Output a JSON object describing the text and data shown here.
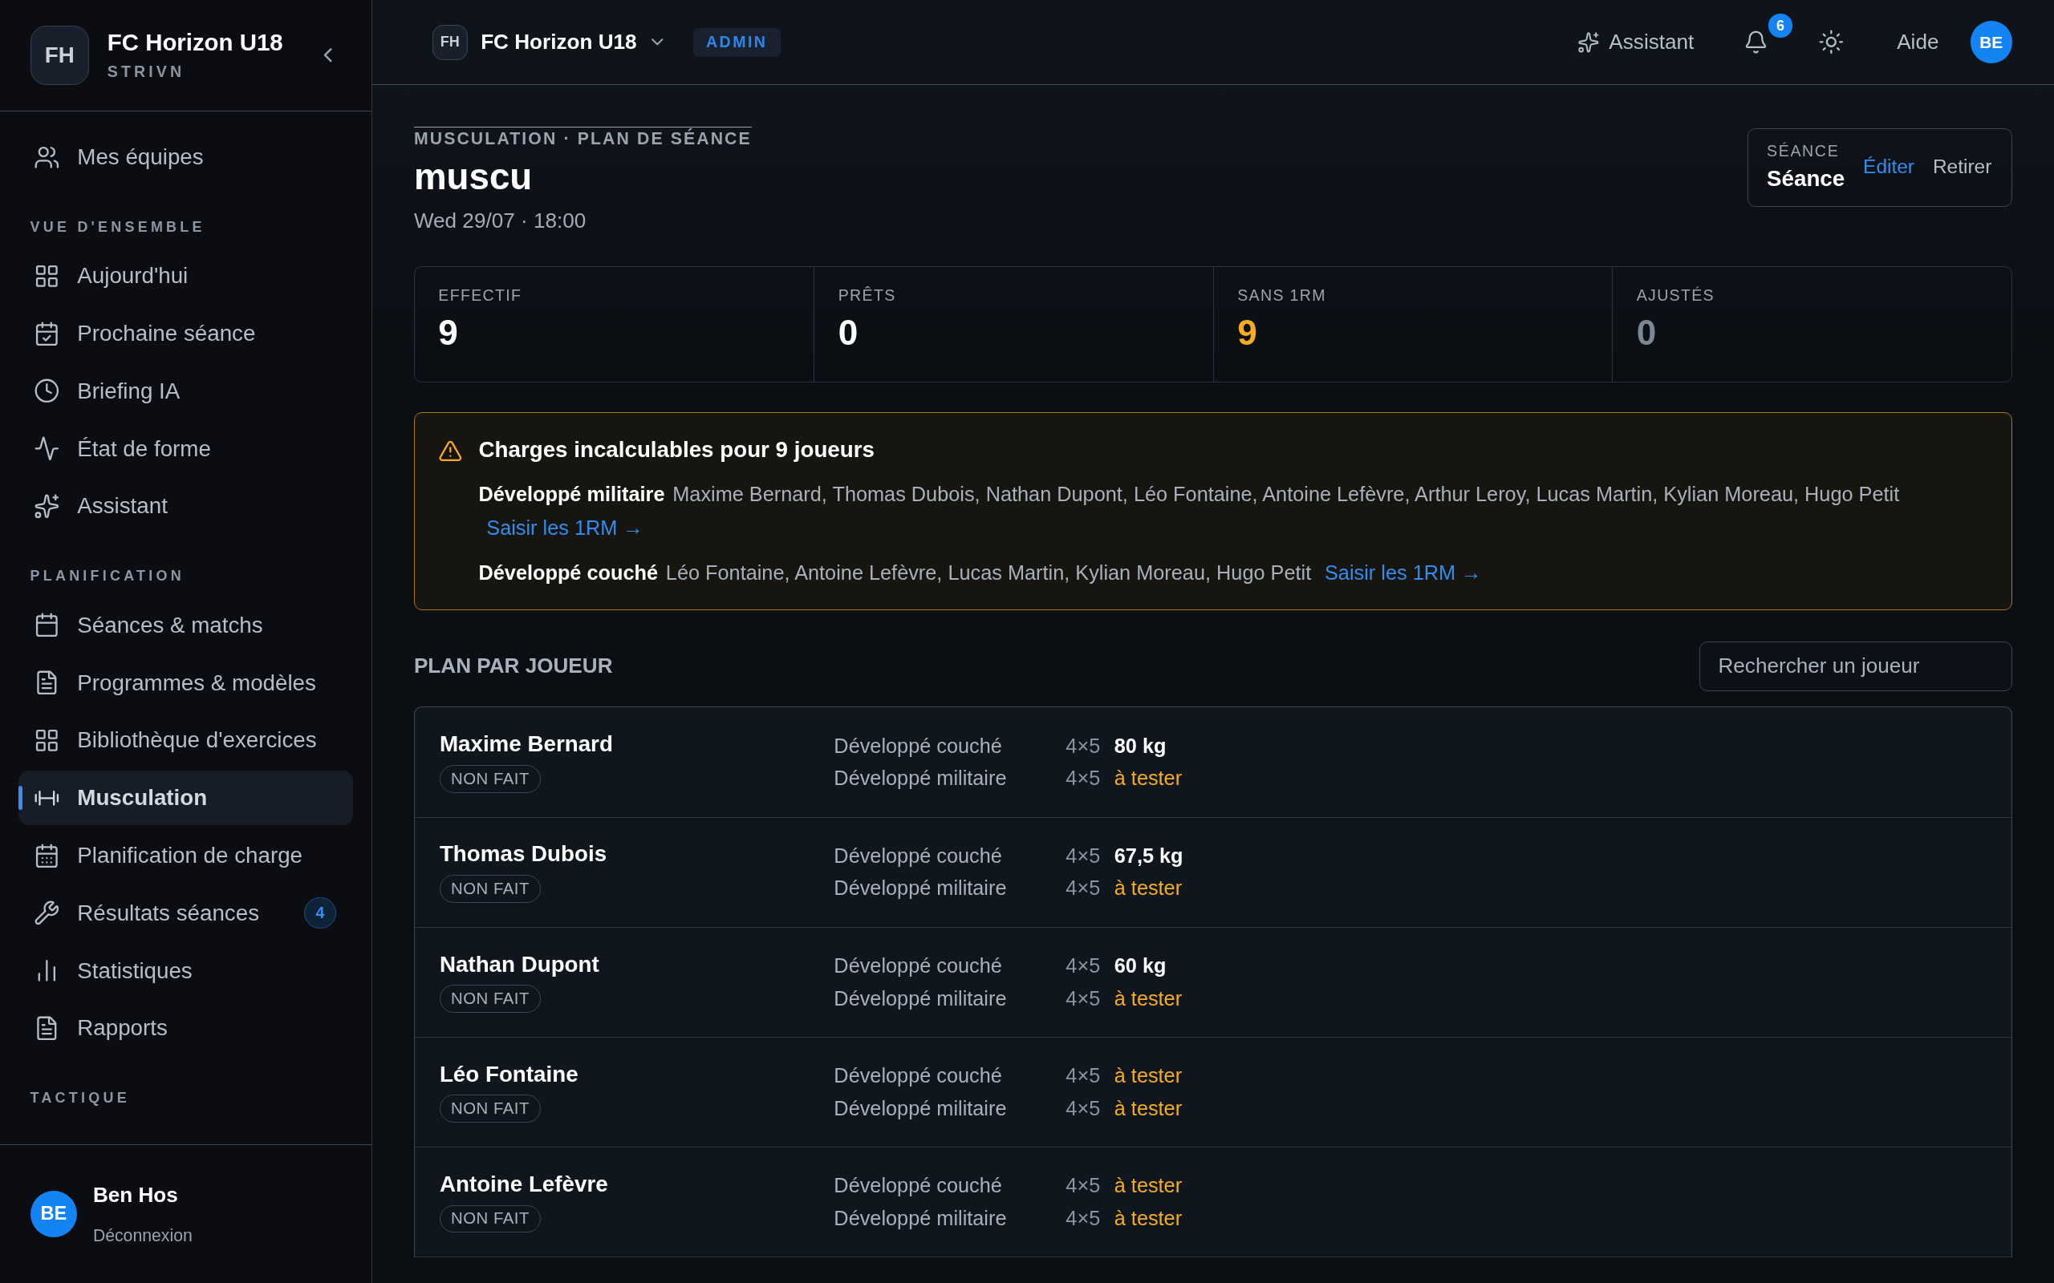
{
  "sidebar": {
    "brand": {
      "initials": "FH",
      "name": "FC Horizon U18",
      "subtitle": "STRIVN"
    },
    "top_item": {
      "label": "Mes équipes",
      "selected": false
    },
    "sections": [
      {
        "title": "VUE D'ENSEMBLE",
        "items": [
          {
            "label": "Aujourd'hui",
            "selected": false
          },
          {
            "label": "Prochaine séance",
            "selected": false
          },
          {
            "label": "Briefing IA",
            "selected": false
          },
          {
            "label": "État de forme",
            "selected": false
          },
          {
            "label": "Assistant",
            "selected": false
          }
        ]
      },
      {
        "title": "PLANIFICATION",
        "items": [
          {
            "label": "Séances & matchs",
            "selected": false
          },
          {
            "label": "Programmes & modèles",
            "selected": false
          },
          {
            "label": "Bibliothèque d'exercices",
            "selected": false
          },
          {
            "label": "Musculation",
            "selected": true
          },
          {
            "label": "Planification de charge",
            "selected": false
          },
          {
            "label": "Résultats séances",
            "selected": false,
            "badge": "4"
          },
          {
            "label": "Statistiques",
            "selected": false
          },
          {
            "label": "Rapports",
            "selected": false
          }
        ]
      },
      {
        "title": "TACTIQUE"
      }
    ],
    "user": {
      "initials": "BE",
      "name": "Ben Hos",
      "action": "Déconnexion"
    }
  },
  "topbar": {
    "initials": "FH",
    "team": "FC Horizon U18",
    "role": "ADMIN",
    "assistant": "Assistant",
    "notifications": "6",
    "help": "Aide",
    "avatar": "BE"
  },
  "page": {
    "eyebrow": "MUSCULATION · PLAN DE SÉANCE",
    "title": "muscu",
    "date": "Wed 29/07 · 18:00",
    "session": {
      "label": "SÉANCE",
      "value": "Séance",
      "edit": "Éditer",
      "remove": "Retirer"
    }
  },
  "stats": [
    {
      "label": "EFFECTIF",
      "value": "9",
      "kind": "normal"
    },
    {
      "label": "PRÊTS",
      "value": "0",
      "kind": "normal"
    },
    {
      "label": "SANS 1RM",
      "value": "9",
      "kind": "warning"
    },
    {
      "label": "AJUSTÉS",
      "value": "0",
      "kind": "muted"
    }
  ],
  "alert": {
    "title": "Charges incalculables pour 9 joueurs",
    "groups": [
      {
        "exercise": "Développé militaire",
        "players": "Maxime Bernard, Thomas Dubois, Nathan Dupont, Léo Fontaine, Antoine Lefèvre, Arthur Leroy, Lucas Martin, Kylian Moreau, Hugo Petit",
        "link": "Saisir les 1RM →"
      },
      {
        "exercise": "Développé couché",
        "players": "Léo Fontaine, Antoine Lefèvre, Lucas Martin, Kylian Moreau, Hugo Petit",
        "link": "Saisir les 1RM →"
      }
    ]
  },
  "plan": {
    "title": "PLAN PAR JOUEUR",
    "search_placeholder": "Rechercher un joueur",
    "rows": [
      {
        "name": "Maxime Bernard",
        "status": "NON FAIT",
        "exercises": [
          {
            "name": "Développé couché",
            "scheme": "4×5",
            "load": "80 kg",
            "kind": "load"
          },
          {
            "name": "Développé militaire",
            "scheme": "4×5",
            "load": "à tester",
            "kind": "test"
          }
        ]
      },
      {
        "name": "Thomas Dubois",
        "status": "NON FAIT",
        "exercises": [
          {
            "name": "Développé couché",
            "scheme": "4×5",
            "load": "67,5 kg",
            "kind": "load"
          },
          {
            "name": "Développé militaire",
            "scheme": "4×5",
            "load": "à tester",
            "kind": "test"
          }
        ]
      },
      {
        "name": "Nathan Dupont",
        "status": "NON FAIT",
        "exercises": [
          {
            "name": "Développé couché",
            "scheme": "4×5",
            "load": "60 kg",
            "kind": "load"
          },
          {
            "name": "Développé militaire",
            "scheme": "4×5",
            "load": "à tester",
            "kind": "test"
          }
        ]
      },
      {
        "name": "Léo Fontaine",
        "status": "NON FAIT",
        "exercises": [
          {
            "name": "Développé couché",
            "scheme": "4×5",
            "load": "à tester",
            "kind": "test"
          },
          {
            "name": "Développé militaire",
            "scheme": "4×5",
            "load": "à tester",
            "kind": "test"
          }
        ]
      },
      {
        "name": "Antoine Lefèvre",
        "status": "NON FAIT",
        "exercises": [
          {
            "name": "Développé couché",
            "scheme": "4×5",
            "load": "à tester",
            "kind": "test"
          },
          {
            "name": "Développé militaire",
            "scheme": "4×5",
            "load": "à tester",
            "kind": "test"
          }
        ]
      }
    ]
  }
}
